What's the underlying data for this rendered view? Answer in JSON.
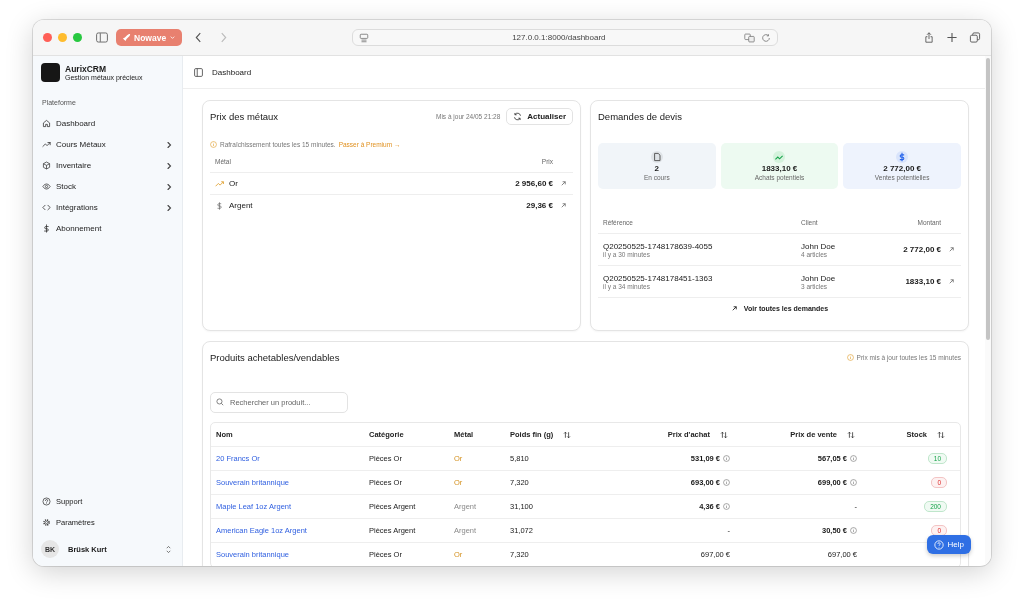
{
  "browser": {
    "tab_button": "Nowave",
    "url": "127.0.0.1:8000/dashboard"
  },
  "sidebar": {
    "brand": "AurixCRM",
    "tagline": "Gestion métaux précieux",
    "section": "Plateforme",
    "items": [
      {
        "label": "Dashboard",
        "kind": "home",
        "expandable": false
      },
      {
        "label": "Cours Métaux",
        "kind": "trend",
        "expandable": true
      },
      {
        "label": "Inventaire",
        "kind": "box",
        "expandable": true
      },
      {
        "label": "Stock",
        "kind": "eye",
        "expandable": true
      },
      {
        "label": "Intégrations",
        "kind": "code",
        "expandable": true
      },
      {
        "label": "Abonnement",
        "kind": "dollar",
        "expandable": false
      }
    ],
    "footer_items": [
      {
        "label": "Support",
        "kind": "help"
      },
      {
        "label": "Paramètres",
        "kind": "gear"
      }
    ],
    "user": {
      "initials": "BK",
      "name": "Brüsk Kurt"
    }
  },
  "header": {
    "title": "Dashboard"
  },
  "metal_prices": {
    "title": "Prix des métaux",
    "updated": "Mis à jour 24/05 21:28",
    "button": "Actualiser",
    "notice": "Rafraîchissement toutes les 15 minutes.",
    "notice_link": "Passer à Premium →",
    "columns": [
      "Métal",
      "Prix"
    ],
    "rows": [
      {
        "kind": "trend",
        "metal": "Or",
        "price": "2 956,60 €"
      },
      {
        "kind": "dollar",
        "metal": "Argent",
        "price": "29,36 €"
      }
    ]
  },
  "quotes": {
    "title": "Demandes de devis",
    "stats": [
      {
        "kind": "neutral",
        "value": "2",
        "label": "En cours"
      },
      {
        "kind": "buy",
        "value": "1833,10 €",
        "label": "Achats potentiels"
      },
      {
        "kind": "sell",
        "value": "2 772,00 €",
        "label": "Ventes potentielles"
      }
    ],
    "columns": [
      "Référence",
      "Client",
      "Montant"
    ],
    "rows": [
      {
        "reference": "Q20250525-1748178639-4055",
        "age": "il y a 30 minutes",
        "client": "John Doe",
        "items": "4 articles",
        "amount": "2 772,00 €"
      },
      {
        "reference": "Q20250525-1748178451-1363",
        "age": "il y a 34 minutes",
        "client": "John Doe",
        "items": "3 articles",
        "amount": "1833,10 €"
      }
    ],
    "footer_link": "Voir toutes les demandes"
  },
  "products": {
    "title": "Produits achetables/vendables",
    "notice": "Prix mis à jour toutes les 15 minutes",
    "search": {
      "placeholder": "Rechercher un produit..."
    },
    "columns": [
      {
        "label": "Nom",
        "sortable": false
      },
      {
        "label": "Catégorie",
        "sortable": false
      },
      {
        "label": "Métal",
        "sortable": false
      },
      {
        "label": "Poids fin (g)",
        "sortable": true
      },
      {
        "label": "Prix d'achat",
        "sortable": true
      },
      {
        "label": "Prix de vente",
        "sortable": true
      },
      {
        "label": "Stock",
        "sortable": true
      }
    ],
    "rows": [
      {
        "name": "20 Francs Or",
        "category": "Pièces Or",
        "metal": {
          "text": "Or",
          "kind": "gold"
        },
        "weight": "5,810",
        "buy": {
          "text": "531,09 €",
          "info": true
        },
        "sell": {
          "text": "567,05 €",
          "info": true
        },
        "stock": {
          "text": "10",
          "kind": "in_stock"
        }
      },
      {
        "name": "Souverain britannique",
        "category": "Pièces Or",
        "metal": {
          "text": "Or",
          "kind": "gold"
        },
        "weight": "7,320",
        "buy": {
          "text": "693,00 €",
          "info": true
        },
        "sell": {
          "text": "699,00 €",
          "info": true
        },
        "stock": {
          "text": "0",
          "kind": "out_of_stock"
        }
      },
      {
        "name": "Maple Leaf 1oz Argent",
        "category": "Pièces Argent",
        "metal": {
          "text": "Argent",
          "kind": "silver"
        },
        "weight": "31,100",
        "buy": {
          "text": "4,36 €",
          "info": true
        },
        "sell": {
          "text": "-",
          "info": false
        },
        "stock": {
          "text": "200",
          "kind": "in_stock"
        }
      },
      {
        "name": "American Eagle 1oz Argent",
        "category": "Pièces Argent",
        "metal": {
          "text": "Argent",
          "kind": "silver"
        },
        "weight": "31,072",
        "buy": {
          "text": "-",
          "info": false
        },
        "sell": {
          "text": "30,50 €",
          "info": true
        },
        "stock": {
          "text": "0",
          "kind": "out_of_stock"
        }
      },
      {
        "name": "Souverain britannique",
        "category": "Pièces Or",
        "metal": {
          "text": "Or",
          "kind": "gold"
        },
        "weight": "7,320",
        "buy": {
          "text": "697,00 €",
          "info": false
        },
        "sell": {
          "text": "697,00 €",
          "info": false
        }
      }
    ]
  },
  "help_button": "Help"
}
